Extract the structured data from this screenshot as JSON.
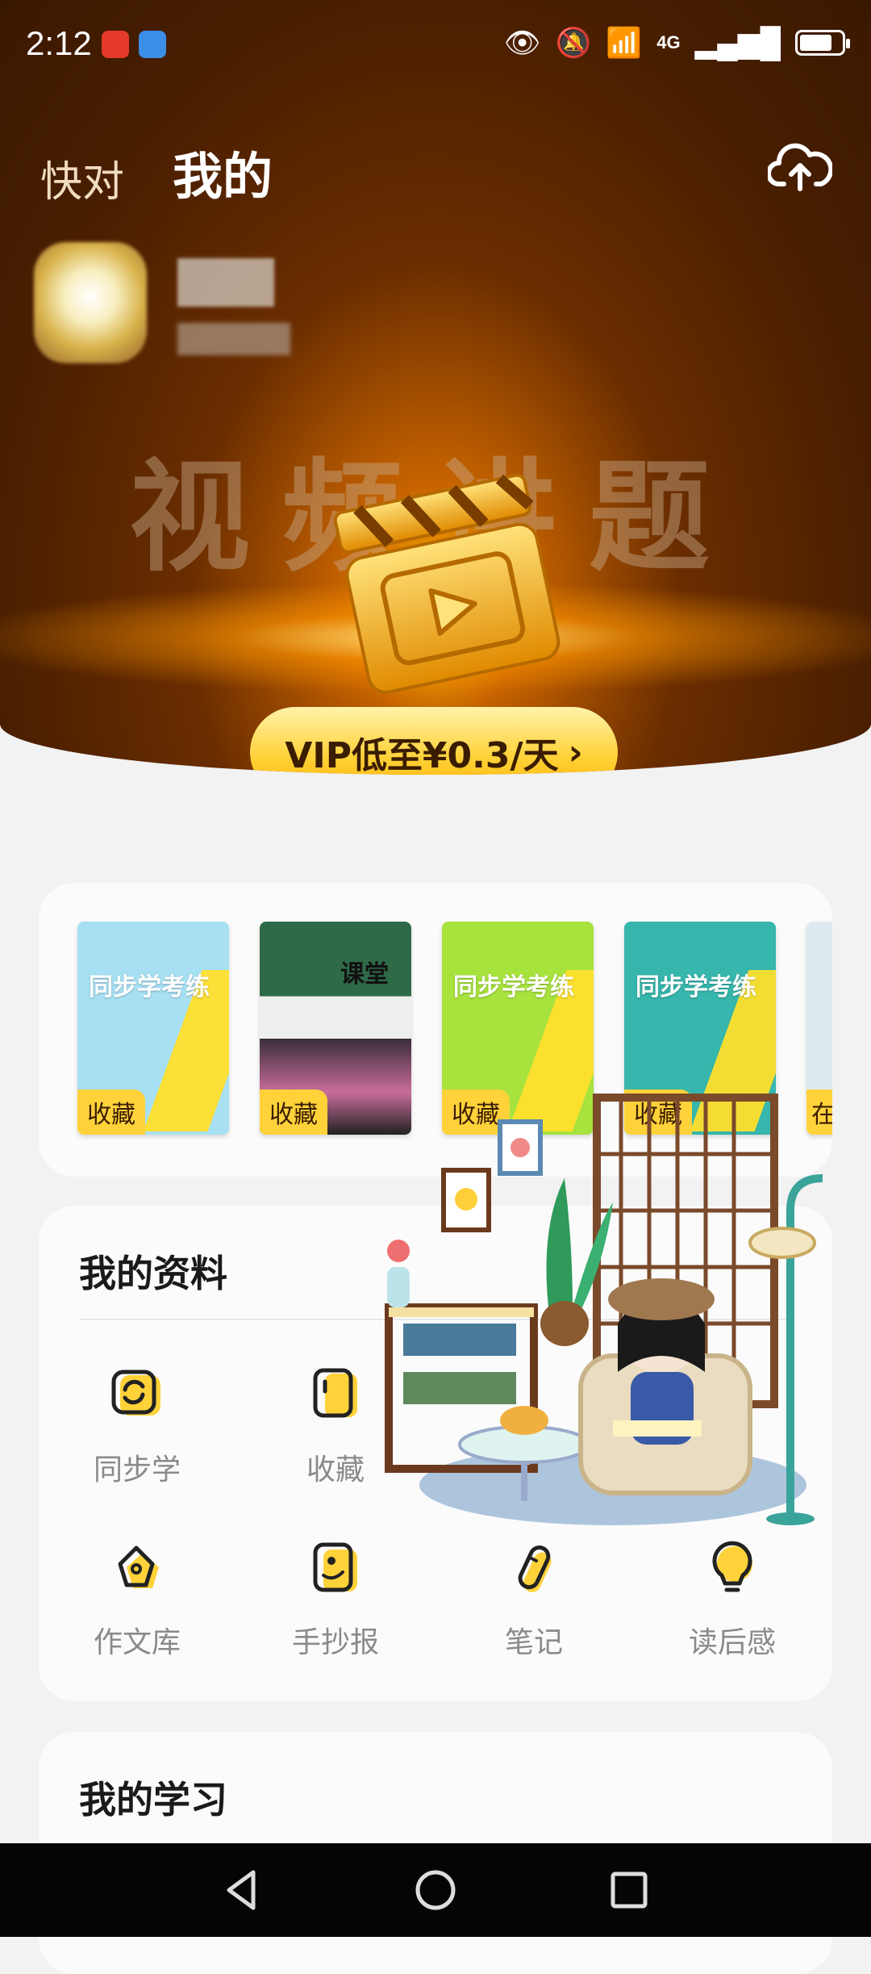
{
  "status_bar": {
    "time": "2:12",
    "network": "4G"
  },
  "header": {
    "tabs": [
      {
        "label": "快对",
        "active": false
      },
      {
        "label": "我的",
        "active": true
      }
    ],
    "upload_icon": "cloud-upload-icon"
  },
  "promo": {
    "banner_text": "视频讲题",
    "vip_button_label": "VIP低至¥0.3/天",
    "vip_arrow": "›"
  },
  "books": {
    "items": [
      {
        "title": "同步学考练",
        "badge": "收藏"
      },
      {
        "title": "课堂",
        "badge": "收藏"
      },
      {
        "title": "同步学考练",
        "badge": "收藏"
      },
      {
        "title": "同步学考练",
        "badge": "收藏"
      },
      {
        "title": "",
        "badge": "在"
      }
    ]
  },
  "materials": {
    "title": "我的资料",
    "items": [
      {
        "label": "同步学",
        "icon": "sync-icon"
      },
      {
        "label": "收藏",
        "icon": "bookmark-icon"
      },
      {
        "label": "作文库",
        "icon": "pen-nib-icon"
      },
      {
        "label": "手抄报",
        "icon": "poster-icon"
      },
      {
        "label": "笔记",
        "icon": "pencil-icon"
      },
      {
        "label": "读后感",
        "icon": "bulb-icon"
      }
    ]
  },
  "study": {
    "title": "我的学习"
  },
  "colors": {
    "accent": "#ffd23a",
    "hero_dark": "#4a1f00",
    "label_gray": "#8a8a8a"
  }
}
